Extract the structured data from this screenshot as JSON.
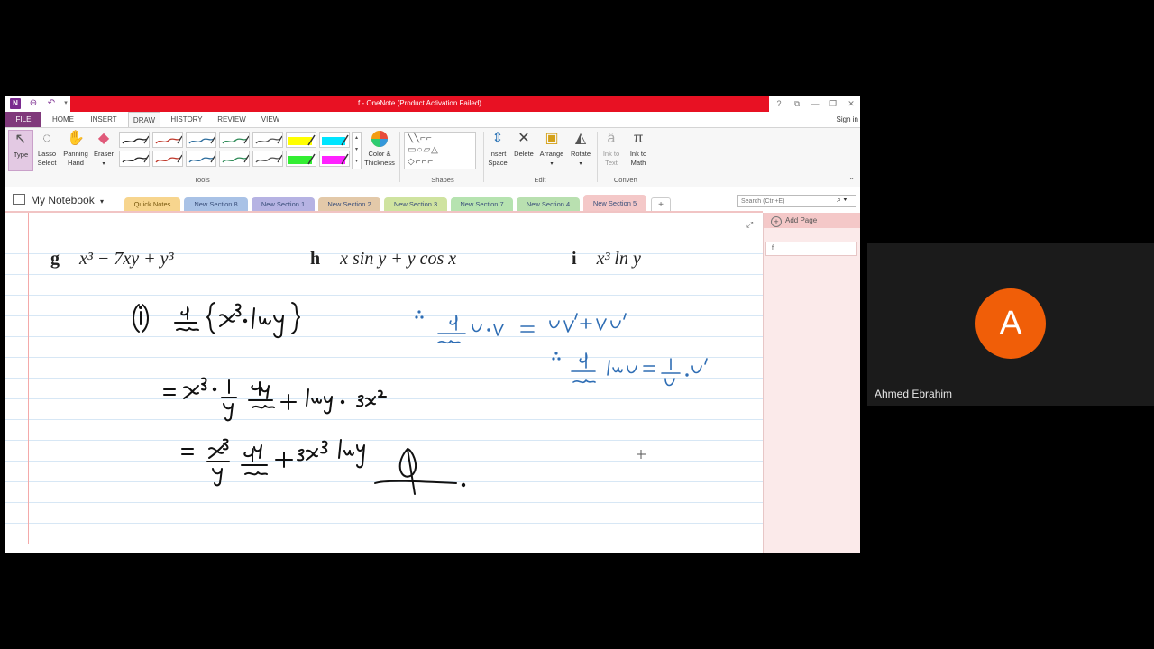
{
  "window": {
    "title": "f - OneNote (Product Activation Failed)",
    "controls": [
      "?",
      "⧉",
      "—",
      "❐",
      "✕"
    ]
  },
  "ribbon_tabs": [
    "FILE",
    "HOME",
    "INSERT",
    "DRAW",
    "HISTORY",
    "REVIEW",
    "VIEW"
  ],
  "active_tab": "DRAW",
  "sign_in": "Sign in",
  "tools": {
    "type": "Type",
    "lasso_1": "Lasso",
    "lasso_2": "Select",
    "panning_1": "Panning",
    "panning_2": "Hand",
    "eraser": "Eraser",
    "color_1": "Color &",
    "color_2": "Thickness",
    "insert_1": "Insert",
    "insert_2": "Space",
    "delete": "Delete",
    "arrange": "Arrange",
    "rotate": "Rotate",
    "ink_text_1": "Ink to",
    "ink_text_2": "Text",
    "ink_math_1": "Ink to",
    "ink_math_2": "Math"
  },
  "groups": {
    "tools": "Tools",
    "shapes": "Shapes",
    "edit": "Edit",
    "convert": "Convert"
  },
  "pen_colors": [
    "#222222",
    "#c0392b",
    "#2e6e9e",
    "#2e8b57",
    "#555555",
    "#ffff00",
    "#00e5ff",
    "#222222",
    "#c0392b",
    "#2e6e9e",
    "#2e8b57",
    "#555555",
    "#33ee33",
    "#ff22ff"
  ],
  "notebook": {
    "name": "My Notebook"
  },
  "sections": [
    {
      "label": "Quick Notes",
      "color": "#f7d58e"
    },
    {
      "label": "New Section 8",
      "color": "#a9c2e6"
    },
    {
      "label": "New Section 1",
      "color": "#b6b3e3"
    },
    {
      "label": "New Section 2",
      "color": "#e3c9a9"
    },
    {
      "label": "New Section 3",
      "color": "#cfe3a0"
    },
    {
      "label": "New Section 7",
      "color": "#b6e3b0"
    },
    {
      "label": "New Section 4",
      "color": "#b9e0b0"
    },
    {
      "label": "New Section 5",
      "color": "#f4c8c8"
    }
  ],
  "active_section": "New Section 5",
  "add_section": "+",
  "search": {
    "placeholder": "Search (Ctrl+E)"
  },
  "page_content": {
    "problems": [
      {
        "label": "g",
        "expr": "x³ − 7xy + y³"
      },
      {
        "label": "h",
        "expr": "x sin y + y cos x"
      },
      {
        "label": "i",
        "expr": "x³ ln y"
      }
    ]
  },
  "pages_pane": {
    "add_page": "Add Page",
    "pages": [
      "f"
    ]
  },
  "participant": {
    "initial": "A",
    "name": "Ahmed Ebrahim",
    "avatar_color": "#f05e08"
  }
}
